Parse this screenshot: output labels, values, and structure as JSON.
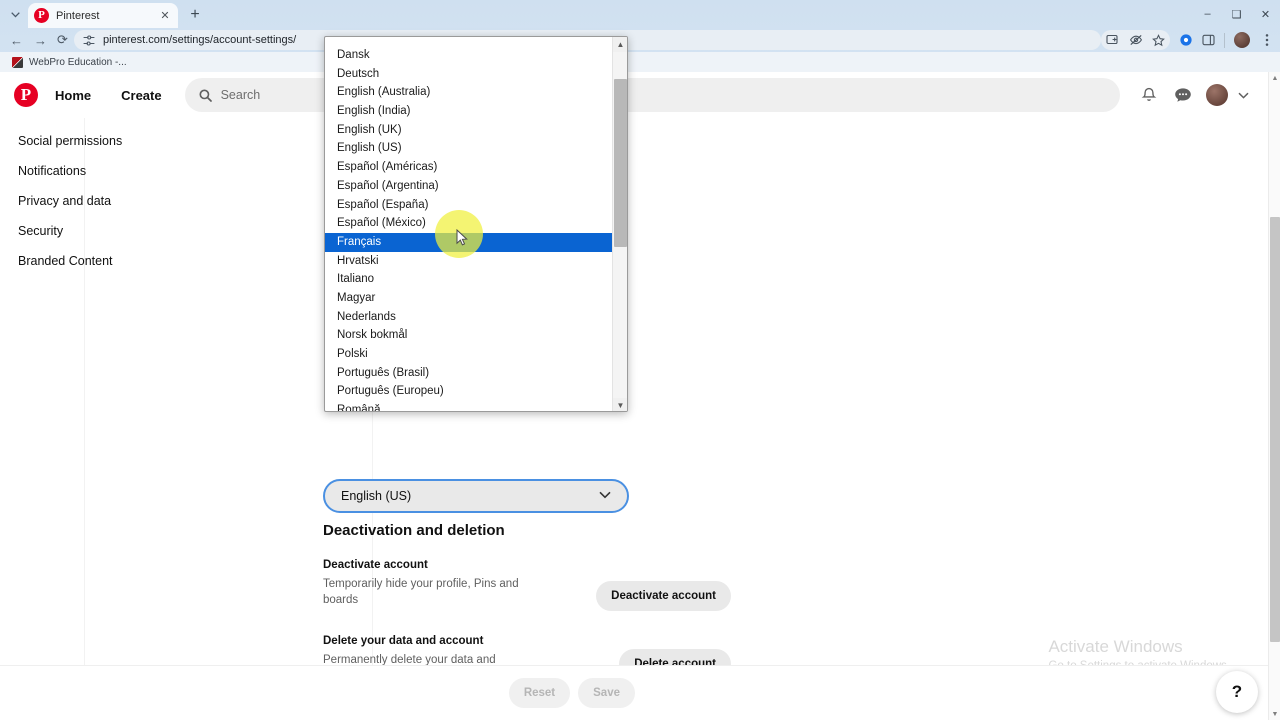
{
  "browser": {
    "tab_search_icon": "chevron-down-icon",
    "tab": {
      "title": "Pinterest",
      "favicon": "pinterest-favicon",
      "close_icon": "close-icon"
    },
    "new_tab_label": "+",
    "window_controls": {
      "minimize": "–",
      "maximize": "❑",
      "close": "✕"
    },
    "nav": {
      "back": "←",
      "forward": "→",
      "reload": "⟳"
    },
    "omnibox": {
      "url": "pinterest.com/settings/account-settings/",
      "site_icon": "site-settings-icon"
    },
    "toolbar_icons": [
      "cast-icon",
      "tracking-protection-icon",
      "bookmark-star-icon",
      "extension-blue-icon",
      "side-panel-icon",
      "profile-avatar-icon",
      "kebab-menu-icon"
    ],
    "bookmarks": [
      {
        "label": "WebPro Education -...",
        "favicon": "webpro-favicon"
      }
    ]
  },
  "pinterest_header": {
    "logo": "pinterest-logo",
    "home_label": "Home",
    "create_label": "Create",
    "search": {
      "placeholder": "Search",
      "value": "",
      "icon": "search-icon"
    },
    "notifications_icon": "bell-icon",
    "messages_icon": "message-icon",
    "avatar": "user-avatar",
    "chevron": "chevron-down-icon"
  },
  "sidebar": {
    "items": [
      {
        "label": "Social permissions"
      },
      {
        "label": "Notifications"
      },
      {
        "label": "Privacy and data"
      },
      {
        "label": "Security"
      },
      {
        "label": "Branded Content"
      }
    ]
  },
  "language_select": {
    "value": "English (US)",
    "chevron": "chevron-down-icon",
    "options": [
      "Dansk",
      "Deutsch",
      "English (Australia)",
      "English (India)",
      "English (UK)",
      "English (US)",
      "Español (Américas)",
      "Español (Argentina)",
      "Español (España)",
      "Español (México)",
      "Français",
      "Hrvatski",
      "Italiano",
      "Magyar",
      "Nederlands",
      "Norsk bokmål",
      "Polski",
      "Português (Brasil)",
      "Português (Europeu)",
      "Română"
    ],
    "highlighted_option": "Français",
    "highlight_color": "#0a64d2"
  },
  "deactivation_section": {
    "title": "Deactivation and deletion",
    "rows": [
      {
        "title": "Deactivate account",
        "description": "Temporarily hide your profile, Pins and boards",
        "button": "Deactivate account"
      },
      {
        "title": "Delete your data and account",
        "description": "Permanently delete your data and everything associated with your account",
        "button": "Delete account"
      }
    ]
  },
  "save_bar": {
    "reset_label": "Reset",
    "save_label": "Save"
  },
  "help_fab": {
    "label": "?"
  },
  "watermark": {
    "title": "Activate Windows",
    "subtitle": "Go to Settings to activate Windows."
  },
  "colors": {
    "pinterest_red": "#e60023",
    "select_highlight": "#0a64d2",
    "focus_ring": "#4a90e2",
    "cursor_halo": "#f0f03c"
  }
}
